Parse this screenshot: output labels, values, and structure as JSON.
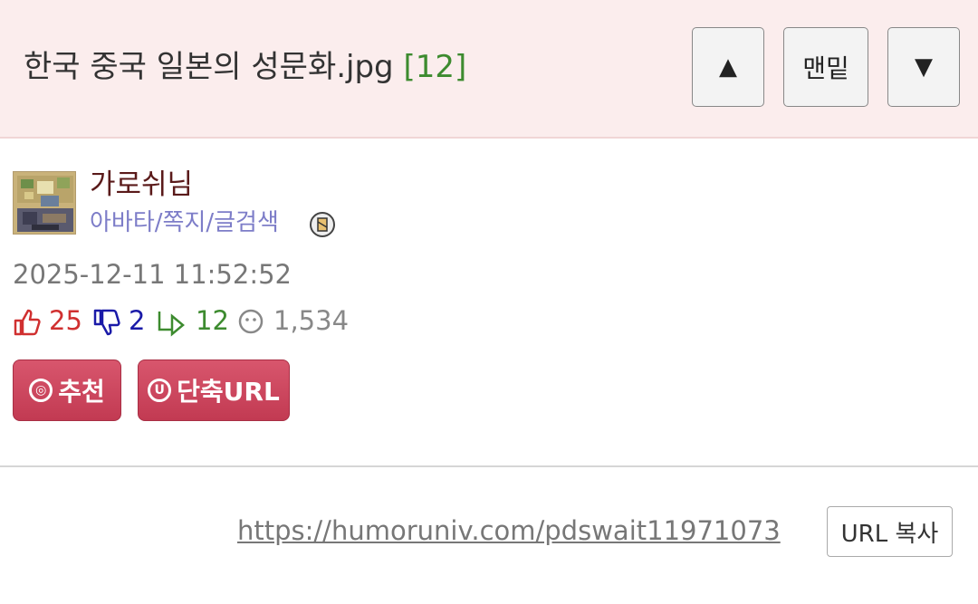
{
  "header": {
    "title": "한국 중국 일본의 성문화.jpg",
    "comment_count": "[12]",
    "up_label": "▲",
    "bottom_label": "맨밑",
    "down_label": "▼"
  },
  "author": {
    "name": "가로쉬님",
    "links": "아바타/쪽지/글검색",
    "badge_icon": "badge-icon"
  },
  "post": {
    "datetime": "2025-12-11 11:52:52",
    "stats": {
      "likes": "25",
      "dislikes": "2",
      "replies": "12",
      "views": "1,534"
    },
    "colors": {
      "likes": "#d03030",
      "dislikes": "#1a1aa8",
      "replies": "#3d8b2f",
      "views": "#888888"
    },
    "actions": {
      "recommend_label": "추천",
      "recommend_icon_glyph": "◎",
      "shorturl_label": "단축URL",
      "shorturl_icon_glyph": "U"
    },
    "url": "https://humoruniv.com/pdswait11971073",
    "copy_label": "URL 복사"
  }
}
